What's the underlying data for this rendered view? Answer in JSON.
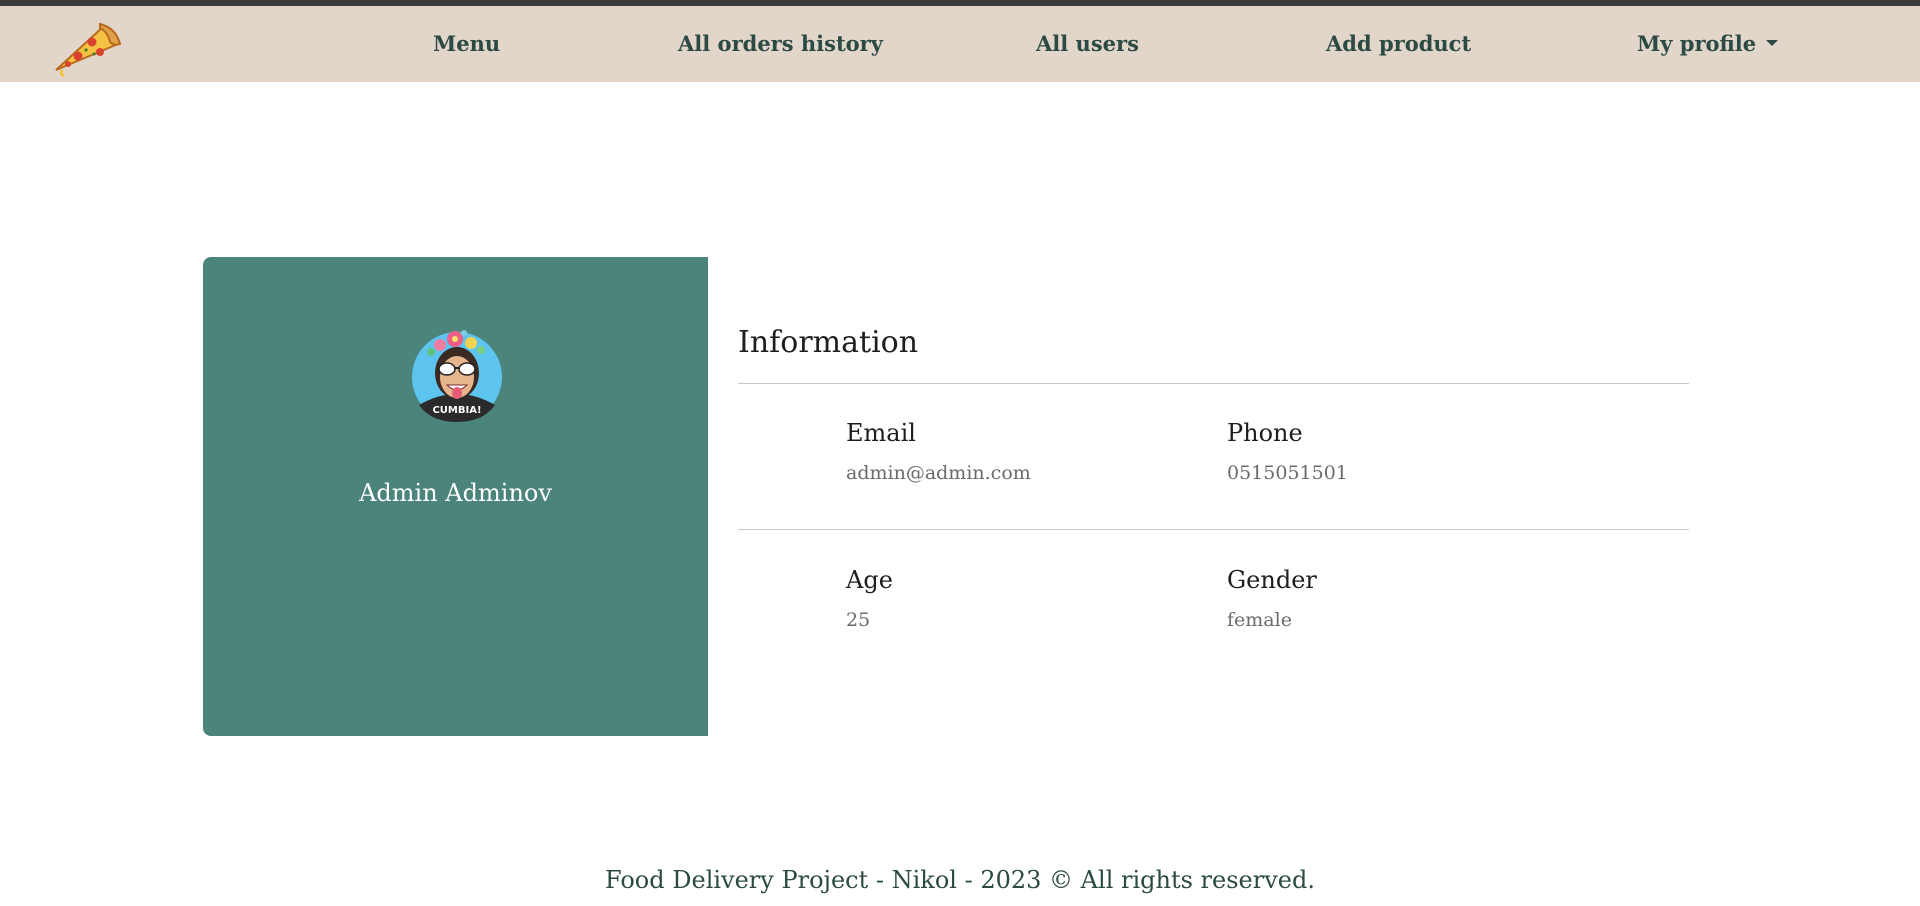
{
  "nav": {
    "logo_icon": "pizza-slice-icon",
    "menu": "Menu",
    "orders_history": "All orders history",
    "users": "All users",
    "add_product": "Add product",
    "my_profile": "My profile"
  },
  "profile": {
    "avatar_icon": "user-avatar",
    "name": "Admin Adminov",
    "info_title": "Information",
    "email_label": "Email",
    "email_value": "admin@admin.com",
    "phone_label": "Phone",
    "phone_value": "0515051501",
    "age_label": "Age",
    "age_value": "25",
    "gender_label": "Gender",
    "gender_value": "female"
  },
  "footer": {
    "text": "Food Delivery Project - Nikol - 2023 © All rights reserved."
  },
  "colors": {
    "navbar": "#e2d6cb",
    "nav_text": "#2c4a44",
    "card": "#4a847a",
    "top_strip": "#3a3a3a"
  }
}
